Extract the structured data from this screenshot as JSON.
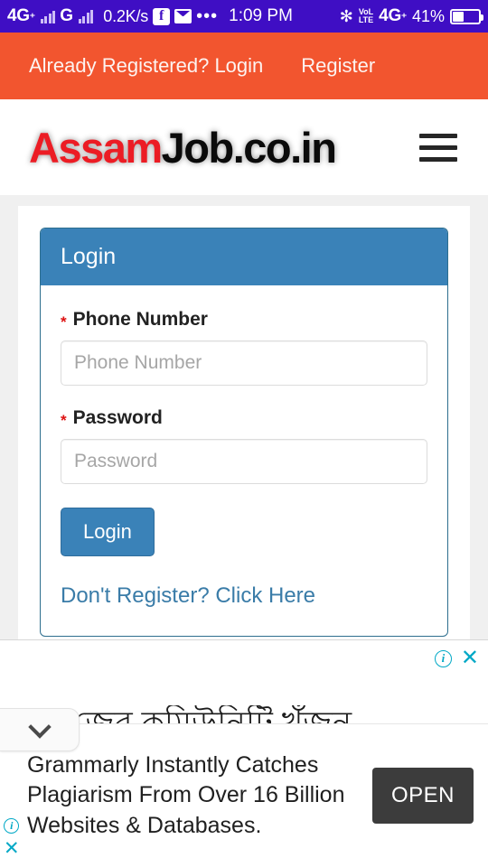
{
  "status_bar": {
    "network_1": "4G",
    "network_1_sup": "⁺",
    "network_2": "G",
    "data_speed": "0.2K/s",
    "facebook_icon": "f",
    "mail_icon": "mail-icon",
    "more_dots": "•••",
    "clock": "1:09 PM",
    "bluetooth_icon": "✻",
    "volte_line1": "VoL",
    "volte_line2": "LTE",
    "network_3": "4G",
    "network_3_sup": "⁺",
    "battery_pct": "41%",
    "bg_color": "#3f0ec4"
  },
  "top_nav": {
    "login_label": "Already Registered? Login",
    "register_label": "Register",
    "bg_color": "#f2552f"
  },
  "logo_bar": {
    "logo_red": "Assam",
    "logo_black": "Job.co.in",
    "menu_icon": "hamburger-icon"
  },
  "login_panel": {
    "title": "Login",
    "header_color": "#3a82b8",
    "required_mark": "*",
    "phone": {
      "label": "Phone Number",
      "placeholder": "Phone Number",
      "value": ""
    },
    "password": {
      "label": "Password",
      "placeholder": "Password",
      "value": ""
    },
    "submit_label": "Login",
    "register_link": "Don't Register? Click Here",
    "link_color": "#3a7ca8"
  },
  "ad": {
    "info_icon": "ⓘ",
    "close_icon": "✕",
    "collapse_icon": "chevron-down-icon",
    "background_text": "জের কমিউনিটি খুঁজুন",
    "headline": "Grammarly Instantly Catches Plagiarism From Over 16 Billion Websites & Databases.",
    "cta_label": "OPEN",
    "cta_color": "#3c3c3c",
    "accent_color": "#00a8c6"
  }
}
